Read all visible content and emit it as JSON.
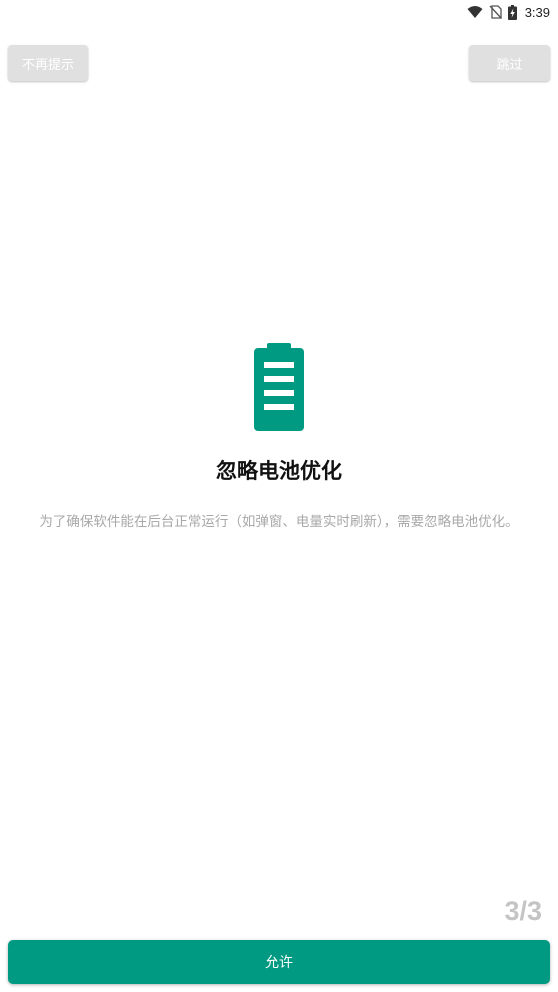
{
  "status_bar": {
    "time": "3:39",
    "icons": [
      "wifi-icon",
      "no-sim-icon",
      "battery-charging-icon"
    ]
  },
  "header": {
    "no_remind_label": "不再提示",
    "skip_label": "跳过"
  },
  "main": {
    "icon": "battery-full-icon",
    "title": "忽略电池优化",
    "description": "为了确保软件能在后台正常运行（如弹窗、电量实时刷新），需要忽略电池优化。"
  },
  "footer": {
    "page_indicator": "3/3",
    "allow_label": "允许"
  },
  "colors": {
    "accent": "#009a82",
    "secondary_button": "#e0e0e0",
    "muted_text": "#a8a8a8"
  }
}
